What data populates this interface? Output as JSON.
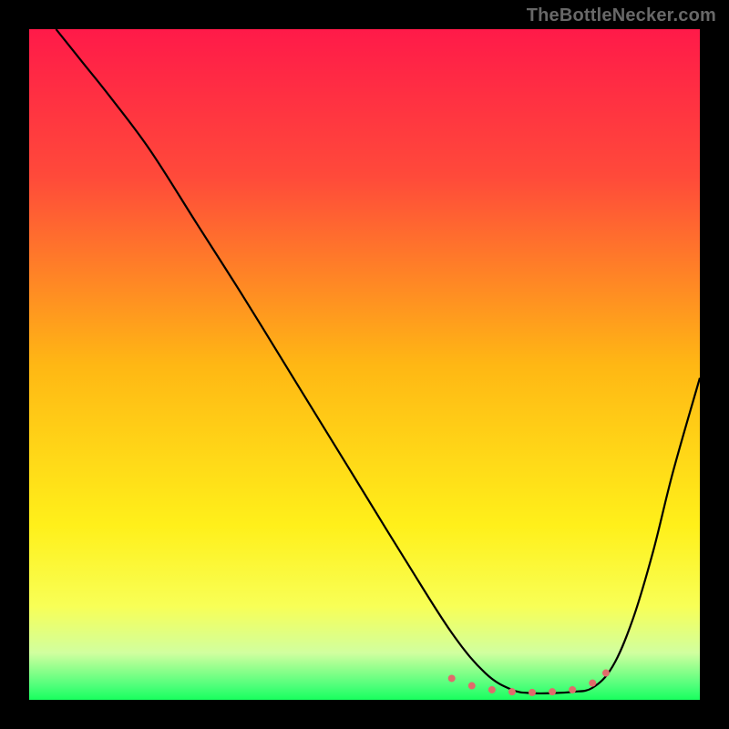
{
  "watermark": "TheBottleNecker.com",
  "chart_data": {
    "type": "line",
    "title": "",
    "xlabel": "",
    "ylabel": "",
    "xlim": [
      0,
      100
    ],
    "ylim": [
      0,
      100
    ],
    "gradient_stops": [
      {
        "offset": 0,
        "color": "#ff1a49"
      },
      {
        "offset": 22,
        "color": "#ff4a3a"
      },
      {
        "offset": 50,
        "color": "#ffb714"
      },
      {
        "offset": 74,
        "color": "#fff01a"
      },
      {
        "offset": 86,
        "color": "#f8ff56"
      },
      {
        "offset": 93,
        "color": "#d1ff9f"
      },
      {
        "offset": 98,
        "color": "#4cff79"
      },
      {
        "offset": 100,
        "color": "#18ff5e"
      }
    ],
    "series": [
      {
        "name": "bottleneck-curve",
        "color": "#000000",
        "x": [
          4,
          8,
          12,
          18,
          25,
          32,
          40,
          48,
          56,
          63,
          68,
          72,
          75,
          78,
          81,
          84,
          87,
          90,
          93,
          96,
          100
        ],
        "y": [
          100,
          95,
          90,
          82,
          71,
          60,
          47,
          34,
          21,
          10,
          4,
          1.5,
          1,
          1,
          1.2,
          1.8,
          5,
          12,
          22,
          34,
          48
        ]
      }
    ],
    "markers": {
      "name": "optimal-range",
      "color": "#e16b6b",
      "size": 8,
      "points": [
        {
          "x": 63,
          "y": 3.2
        },
        {
          "x": 66,
          "y": 2.1
        },
        {
          "x": 69,
          "y": 1.5
        },
        {
          "x": 72,
          "y": 1.2
        },
        {
          "x": 75,
          "y": 1.1
        },
        {
          "x": 78,
          "y": 1.2
        },
        {
          "x": 81,
          "y": 1.5
        },
        {
          "x": 84,
          "y": 2.5
        },
        {
          "x": 86,
          "y": 4.0
        }
      ]
    }
  }
}
